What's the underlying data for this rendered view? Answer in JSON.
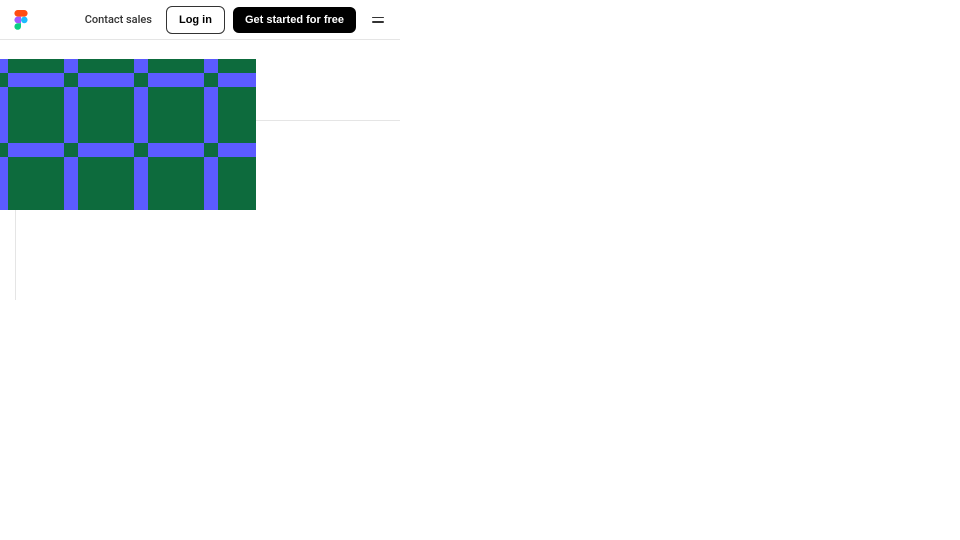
{
  "header": {
    "contact_sales": "Contact sales",
    "login": "Log in",
    "get_started": "Get started for free"
  },
  "pattern": {
    "green": "#0d6b3d",
    "blue": "#5b5bff"
  }
}
